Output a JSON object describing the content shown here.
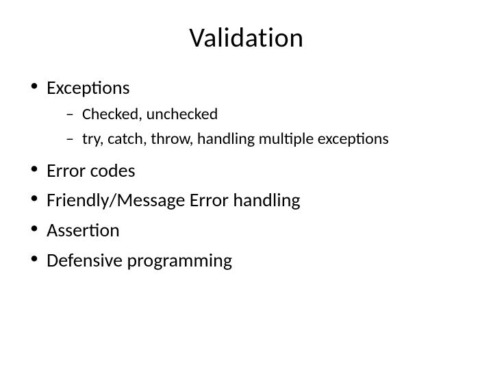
{
  "title": "Validation",
  "bullets": {
    "b1": "Exceptions",
    "b1_sub1": "Checked, unchecked",
    "b1_sub2": "try, catch, throw, handling multiple exceptions",
    "b2": "Error codes",
    "b3": "Friendly/Message Error handling",
    "b4": " Assertion",
    "b5": "Defensive programming"
  }
}
